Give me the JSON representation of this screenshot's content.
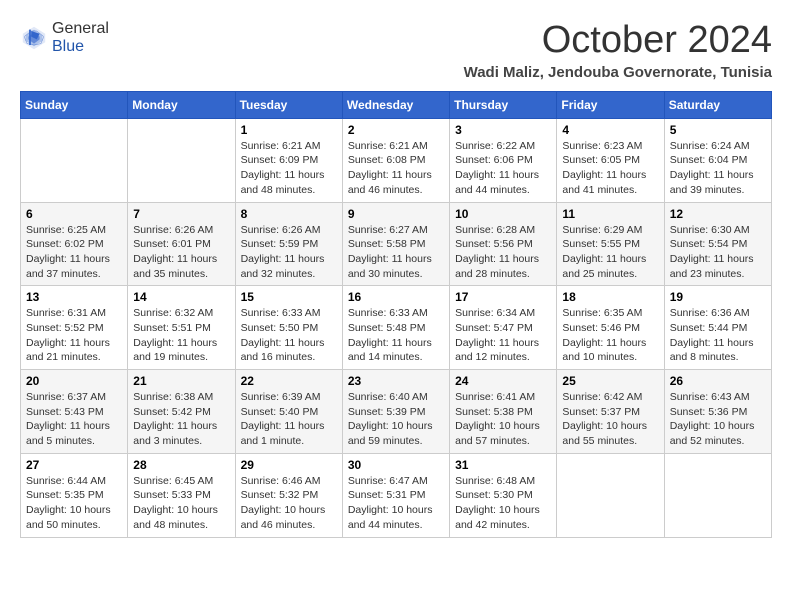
{
  "header": {
    "logo": {
      "line1": "General",
      "line2": "Blue"
    },
    "month": "October 2024",
    "location": "Wadi Maliz, Jendouba Governorate, Tunisia"
  },
  "weekdays": [
    "Sunday",
    "Monday",
    "Tuesday",
    "Wednesday",
    "Thursday",
    "Friday",
    "Saturday"
  ],
  "weeks": [
    [
      {
        "day": "",
        "info": ""
      },
      {
        "day": "",
        "info": ""
      },
      {
        "day": "1",
        "info": "Sunrise: 6:21 AM\nSunset: 6:09 PM\nDaylight: 11 hours and 48 minutes."
      },
      {
        "day": "2",
        "info": "Sunrise: 6:21 AM\nSunset: 6:08 PM\nDaylight: 11 hours and 46 minutes."
      },
      {
        "day": "3",
        "info": "Sunrise: 6:22 AM\nSunset: 6:06 PM\nDaylight: 11 hours and 44 minutes."
      },
      {
        "day": "4",
        "info": "Sunrise: 6:23 AM\nSunset: 6:05 PM\nDaylight: 11 hours and 41 minutes."
      },
      {
        "day": "5",
        "info": "Sunrise: 6:24 AM\nSunset: 6:04 PM\nDaylight: 11 hours and 39 minutes."
      }
    ],
    [
      {
        "day": "6",
        "info": "Sunrise: 6:25 AM\nSunset: 6:02 PM\nDaylight: 11 hours and 37 minutes."
      },
      {
        "day": "7",
        "info": "Sunrise: 6:26 AM\nSunset: 6:01 PM\nDaylight: 11 hours and 35 minutes."
      },
      {
        "day": "8",
        "info": "Sunrise: 6:26 AM\nSunset: 5:59 PM\nDaylight: 11 hours and 32 minutes."
      },
      {
        "day": "9",
        "info": "Sunrise: 6:27 AM\nSunset: 5:58 PM\nDaylight: 11 hours and 30 minutes."
      },
      {
        "day": "10",
        "info": "Sunrise: 6:28 AM\nSunset: 5:56 PM\nDaylight: 11 hours and 28 minutes."
      },
      {
        "day": "11",
        "info": "Sunrise: 6:29 AM\nSunset: 5:55 PM\nDaylight: 11 hours and 25 minutes."
      },
      {
        "day": "12",
        "info": "Sunrise: 6:30 AM\nSunset: 5:54 PM\nDaylight: 11 hours and 23 minutes."
      }
    ],
    [
      {
        "day": "13",
        "info": "Sunrise: 6:31 AM\nSunset: 5:52 PM\nDaylight: 11 hours and 21 minutes."
      },
      {
        "day": "14",
        "info": "Sunrise: 6:32 AM\nSunset: 5:51 PM\nDaylight: 11 hours and 19 minutes."
      },
      {
        "day": "15",
        "info": "Sunrise: 6:33 AM\nSunset: 5:50 PM\nDaylight: 11 hours and 16 minutes."
      },
      {
        "day": "16",
        "info": "Sunrise: 6:33 AM\nSunset: 5:48 PM\nDaylight: 11 hours and 14 minutes."
      },
      {
        "day": "17",
        "info": "Sunrise: 6:34 AM\nSunset: 5:47 PM\nDaylight: 11 hours and 12 minutes."
      },
      {
        "day": "18",
        "info": "Sunrise: 6:35 AM\nSunset: 5:46 PM\nDaylight: 11 hours and 10 minutes."
      },
      {
        "day": "19",
        "info": "Sunrise: 6:36 AM\nSunset: 5:44 PM\nDaylight: 11 hours and 8 minutes."
      }
    ],
    [
      {
        "day": "20",
        "info": "Sunrise: 6:37 AM\nSunset: 5:43 PM\nDaylight: 11 hours and 5 minutes."
      },
      {
        "day": "21",
        "info": "Sunrise: 6:38 AM\nSunset: 5:42 PM\nDaylight: 11 hours and 3 minutes."
      },
      {
        "day": "22",
        "info": "Sunrise: 6:39 AM\nSunset: 5:40 PM\nDaylight: 11 hours and 1 minute."
      },
      {
        "day": "23",
        "info": "Sunrise: 6:40 AM\nSunset: 5:39 PM\nDaylight: 10 hours and 59 minutes."
      },
      {
        "day": "24",
        "info": "Sunrise: 6:41 AM\nSunset: 5:38 PM\nDaylight: 10 hours and 57 minutes."
      },
      {
        "day": "25",
        "info": "Sunrise: 6:42 AM\nSunset: 5:37 PM\nDaylight: 10 hours and 55 minutes."
      },
      {
        "day": "26",
        "info": "Sunrise: 6:43 AM\nSunset: 5:36 PM\nDaylight: 10 hours and 52 minutes."
      }
    ],
    [
      {
        "day": "27",
        "info": "Sunrise: 6:44 AM\nSunset: 5:35 PM\nDaylight: 10 hours and 50 minutes."
      },
      {
        "day": "28",
        "info": "Sunrise: 6:45 AM\nSunset: 5:33 PM\nDaylight: 10 hours and 48 minutes."
      },
      {
        "day": "29",
        "info": "Sunrise: 6:46 AM\nSunset: 5:32 PM\nDaylight: 10 hours and 46 minutes."
      },
      {
        "day": "30",
        "info": "Sunrise: 6:47 AM\nSunset: 5:31 PM\nDaylight: 10 hours and 44 minutes."
      },
      {
        "day": "31",
        "info": "Sunrise: 6:48 AM\nSunset: 5:30 PM\nDaylight: 10 hours and 42 minutes."
      },
      {
        "day": "",
        "info": ""
      },
      {
        "day": "",
        "info": ""
      }
    ]
  ]
}
